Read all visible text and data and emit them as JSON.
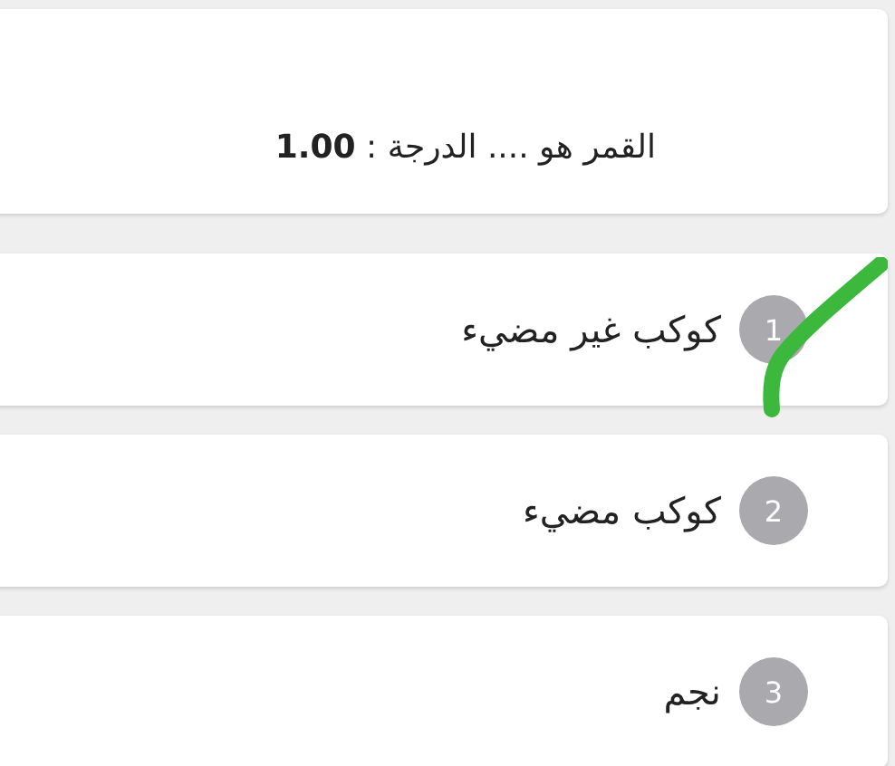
{
  "question": {
    "text": "القمر هو .... الدرجة : **1.00**"
  },
  "options": [
    {
      "number": "1",
      "label": "كوكب غير مضيء",
      "marked": true
    },
    {
      "number": "2",
      "label": "كوكب مضيء",
      "marked": false
    },
    {
      "number": "3",
      "label": "نجم",
      "marked": false
    }
  ]
}
